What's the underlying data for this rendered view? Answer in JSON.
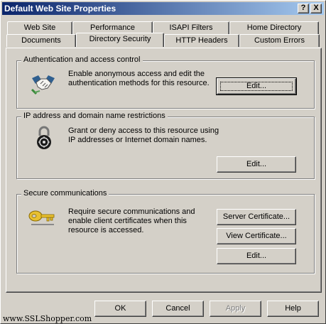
{
  "window": {
    "title": "Default Web Site Properties",
    "help_button": "?",
    "close_button": "X"
  },
  "tabs": {
    "row_back": [
      "Web Site",
      "Performance",
      "ISAPI Filters",
      "Home Directory"
    ],
    "row_front": [
      "Documents",
      "Directory Security",
      "HTTP Headers",
      "Custom Errors"
    ],
    "active": "Directory Security"
  },
  "auth": {
    "title": "Authentication and access control",
    "line1": "Enable anonymous access and edit the",
    "line2": "authentication methods for this resource.",
    "edit_button": "Edit..."
  },
  "ip": {
    "title": "IP address and domain name restrictions",
    "line1": "Grant or deny access to this resource using",
    "line2": "IP addresses or Internet domain names.",
    "edit_button": "Edit..."
  },
  "secure": {
    "title": "Secure communications",
    "line1": "Require secure communications and",
    "line2": "enable client certificates when this",
    "line3": "resource is accessed.",
    "server_cert_button": "Server Certificate...",
    "view_cert_button": "View Certificate...",
    "edit_button": "Edit..."
  },
  "footer": {
    "ok": "OK",
    "cancel": "Cancel",
    "apply": "Apply",
    "help": "Help"
  },
  "watermark": "www.SSLShopper.com",
  "colors": {
    "titlebar_start": "#0a246a",
    "titlebar_end": "#a6caf0",
    "face": "#d4d0c8"
  }
}
